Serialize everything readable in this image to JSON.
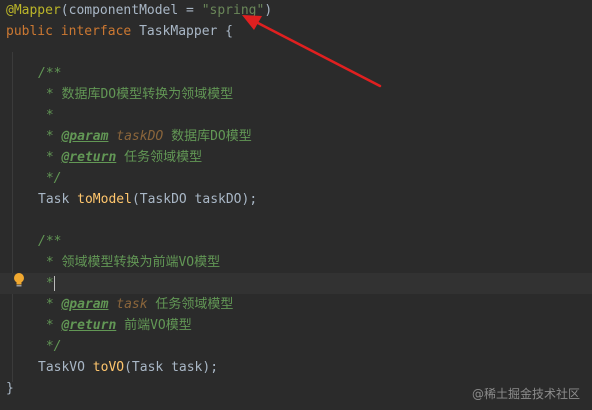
{
  "code": {
    "l1": {
      "at": "@",
      "ann": "Mapper",
      "paren_open": "(",
      "param": "componentModel",
      "eq": " = ",
      "str": "\"spring\"",
      "paren_close": ")"
    },
    "l2": {
      "kw1": "public",
      "kw2": "interface",
      "name": "TaskMapper",
      "brace": " {"
    },
    "doc1": {
      "open": "/**",
      "desc": " * 数据库DO模型转换为领域模型",
      "blank": " *",
      "param_star": " * ",
      "param_tag": "@param",
      "param_name": "taskDO",
      "param_desc": " 数据库DO模型",
      "return_star": " * ",
      "return_tag": "@return",
      "return_desc": " 任务领域模型",
      "close": " */"
    },
    "method1": {
      "ret": "Task ",
      "name": "toModel",
      "args": "(TaskDO taskDO);"
    },
    "doc2": {
      "open": "/**",
      "desc": " * 领域模型转换为前端VO模型",
      "blank": " *",
      "param_star": " * ",
      "param_tag": "@param",
      "param_name": "task",
      "param_desc": " 任务领域模型",
      "return_star": " * ",
      "return_tag": "@return",
      "return_desc": " 前端VO模型",
      "close": " */"
    },
    "method2": {
      "ret": "TaskVO ",
      "name": "toVO",
      "args": "(Task task);"
    },
    "end_brace": "}"
  },
  "intention_icon": "lightbulb-icon",
  "annotation_arrow_color": "#e02020",
  "watermark": "@稀土掘金技术社区"
}
